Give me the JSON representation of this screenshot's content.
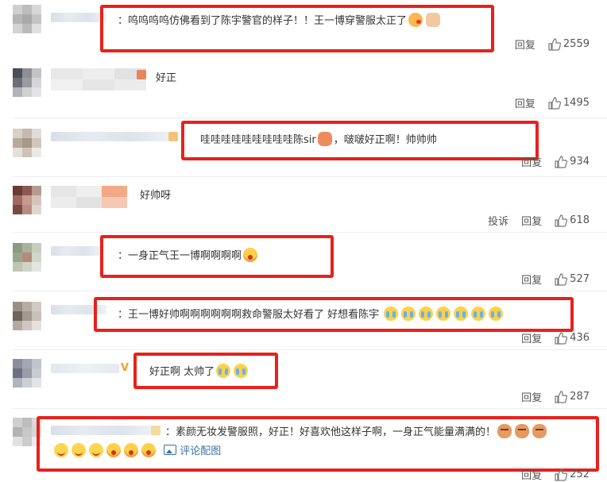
{
  "comments": [
    {
      "text": "：呜呜呜呜仿佛看到了陈宇警官的样子！！王一博穿警服太正了",
      "emojis": [
        "kiss",
        "fist"
      ],
      "actions": [
        "回复"
      ],
      "likes": "2559"
    },
    {
      "text": "好正",
      "emojis": [],
      "actions": [
        "回复"
      ],
      "likes": "1495"
    },
    {
      "text": "哇哇哇哇哇哇哇哇哇陈sir",
      "text_after": "，啵啵好正啊！帅帅帅",
      "emojis": [
        "sir"
      ],
      "actions": [
        "回复"
      ],
      "likes": "934"
    },
    {
      "text": "好帅呀",
      "emojis": [],
      "actions": [
        "投诉",
        "回复"
      ],
      "likes": "618"
    },
    {
      "text": "：一身正气王一博啊啊啊啊",
      "emojis": [
        "shock"
      ],
      "actions": [
        "回复"
      ],
      "likes": "527"
    },
    {
      "text": "：王一博好帅啊啊啊啊啊啊救命警服太好看了 好想看陈宇",
      "emojis": [
        "cry",
        "cry",
        "cry",
        "cry",
        "cry",
        "cry",
        "cry"
      ],
      "actions": [
        "回复"
      ],
      "likes": "436"
    },
    {
      "text": "好正啊 太帅了",
      "emojis": [
        "cry",
        "cry"
      ],
      "actions": [
        "回复"
      ],
      "likes": "287"
    },
    {
      "text": "：素颜无妆发警服照，好正！好喜欢他这样子啊，一身正气能量满满的！",
      "emojis": [
        "doge",
        "doge",
        "doge"
      ],
      "emojis_line2": [
        "smile",
        "smile",
        "smile",
        "shock",
        "shock",
        "shock"
      ],
      "pic_link": "评论配图",
      "actions": [
        "回复"
      ],
      "likes": "252"
    }
  ],
  "colors": {
    "highlight": "#e8211b",
    "link": "#3c70a5"
  }
}
